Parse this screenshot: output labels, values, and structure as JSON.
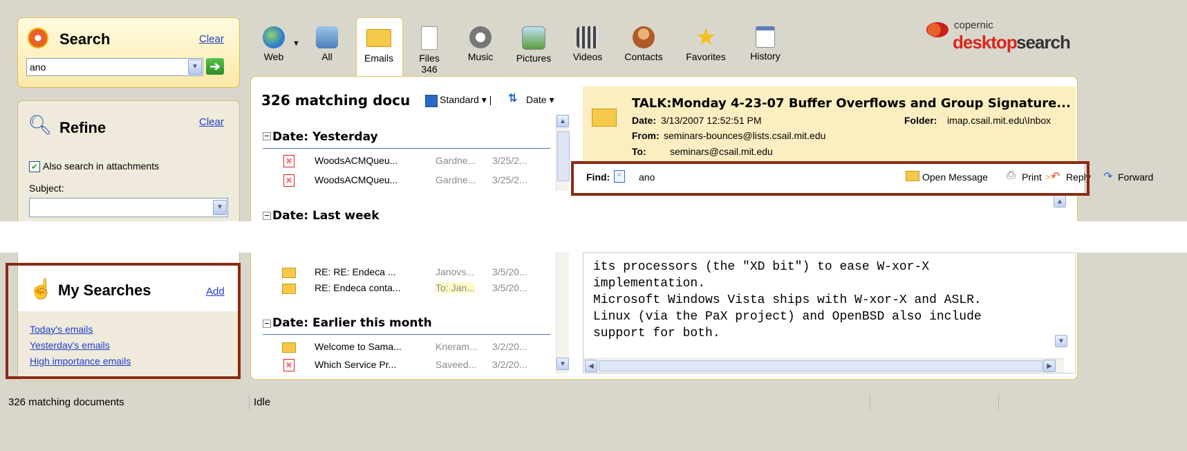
{
  "search": {
    "title": "Search",
    "clear": "Clear",
    "query": "ano"
  },
  "refine": {
    "title": "Refine",
    "clear": "Clear",
    "attachments_label": "Also search in attachments",
    "attachments_checked": true,
    "subject_label": "Subject:"
  },
  "my_searches": {
    "title": "My Searches",
    "add": "Add",
    "items": [
      "Today's emails",
      "Yesterday's emails",
      "High importance emails"
    ]
  },
  "toolbar": {
    "tabs": [
      {
        "label": "Web",
        "sub": ""
      },
      {
        "label": "All",
        "sub": ""
      },
      {
        "label": "Emails",
        "sub": ""
      },
      {
        "label": "Files",
        "sub": "346"
      },
      {
        "label": "Music",
        "sub": ""
      },
      {
        "label": "Pictures",
        "sub": ""
      },
      {
        "label": "Videos",
        "sub": ""
      },
      {
        "label": "Contacts",
        "sub": ""
      },
      {
        "label": "Favorites",
        "sub": ""
      },
      {
        "label": "History",
        "sub": ""
      }
    ]
  },
  "brand": {
    "line1": "copernic",
    "line2a": "desktop",
    "line2b": "search"
  },
  "results": {
    "count_label": "326 matching docu",
    "view_label": "Standard",
    "sort_label": "Date",
    "groups": [
      {
        "label": "Date: Yesterday",
        "rows": [
          {
            "type": "pdf",
            "title": "WoodsACMQueu...",
            "author": "Gardne...",
            "date": "3/25/2..."
          },
          {
            "type": "pdf",
            "title": "WoodsACMQueu...",
            "author": "Gardne...",
            "date": "3/25/2..."
          }
        ]
      },
      {
        "label": "Date: Last week",
        "rows": [
          {
            "type": "email",
            "title": "RE:  RE: Endeca ...",
            "author": "Janovs...",
            "date": "3/5/20..."
          },
          {
            "type": "email",
            "title": "RE: Endeca conta...",
            "author": "To: Jan...",
            "date": "3/5/20..."
          }
        ]
      },
      {
        "label": "Date: Earlier this month",
        "rows": [
          {
            "type": "email",
            "title": "Welcome to Sama...",
            "author": "Kneram...",
            "date": "3/2/20..."
          },
          {
            "type": "pdf",
            "title": "Which Service Pr...",
            "author": "Saveed...",
            "date": "3/2/20..."
          }
        ]
      }
    ]
  },
  "preview": {
    "subject": "TALK:Monday 4-23-07 Buffer Overflows and Group Signature...",
    "date_label": "Date:",
    "date": "3/13/2007 12:52:51 PM",
    "folder_label": "Folder:",
    "folder": "imap.csail.mit.edu\\Inbox",
    "from_label": "From:",
    "from": "seminars-bounces@lists.csail.mit.edu",
    "to_label": "To:",
    "to": "seminars@csail.mit.edu",
    "find_label": "Find:",
    "find_value": "ano",
    "actions": {
      "open": "Open Message",
      "print": "Print",
      "reply": "Reply",
      "forward": "Forward",
      "more": ">>"
    },
    "body_lines": [
      "its processors (the \"XD bit\") to ease W-xor-X",
      "implementation.",
      "Microsoft Windows Vista ships with W-xor-X and ASLR.",
      "Linux (via the PaX project) and OpenBSD also include",
      "support for both."
    ]
  },
  "status": {
    "left": "326 matching documents",
    "middle": "Idle"
  },
  "colors": {
    "accent_red": "#8a2a14",
    "link": "#1f3fcc",
    "panel_bg": "#efeadb",
    "highlight": "#fbeec0"
  }
}
